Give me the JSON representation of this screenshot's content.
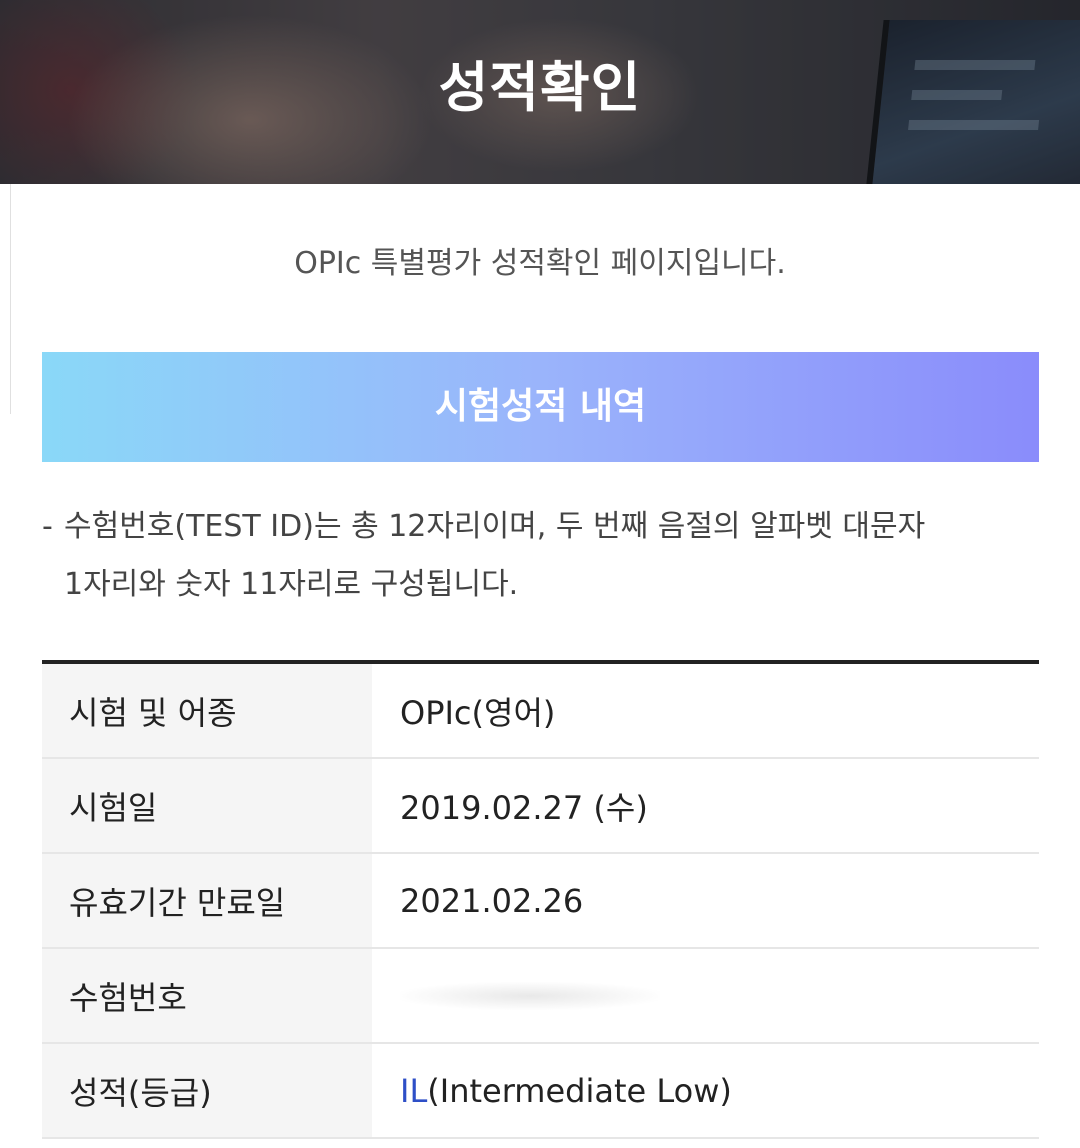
{
  "header": {
    "title": "성적확인"
  },
  "intro": {
    "text": "OPIc 특별평가 성적확인 페이지입니다."
  },
  "section": {
    "title": "시험성적 내역"
  },
  "note": {
    "dash": "-",
    "line1": "수험번호(TEST ID)는 총 12자리이며, 두 번째 음절의 알파벳 대문자",
    "line2": "1자리와 숫자 11자리로 구성됩니다."
  },
  "table": {
    "rows": [
      {
        "label": "시험 및 어종",
        "value": "OPIc(영어)"
      },
      {
        "label": "시험일",
        "value": "2019.02.27 (수)"
      },
      {
        "label": "유효기간 만료일",
        "value": "2021.02.26"
      },
      {
        "label": "수험번호",
        "value": ""
      },
      {
        "label": "성적(등급)",
        "grade_code": "IL",
        "grade_name": "(Intermediate Low)"
      }
    ]
  },
  "colors": {
    "section_gradient_start": "#8ad8f8",
    "section_gradient_end": "#8a8cfb",
    "grade_code": "#2e4fc7",
    "table_top_border": "#222222"
  }
}
